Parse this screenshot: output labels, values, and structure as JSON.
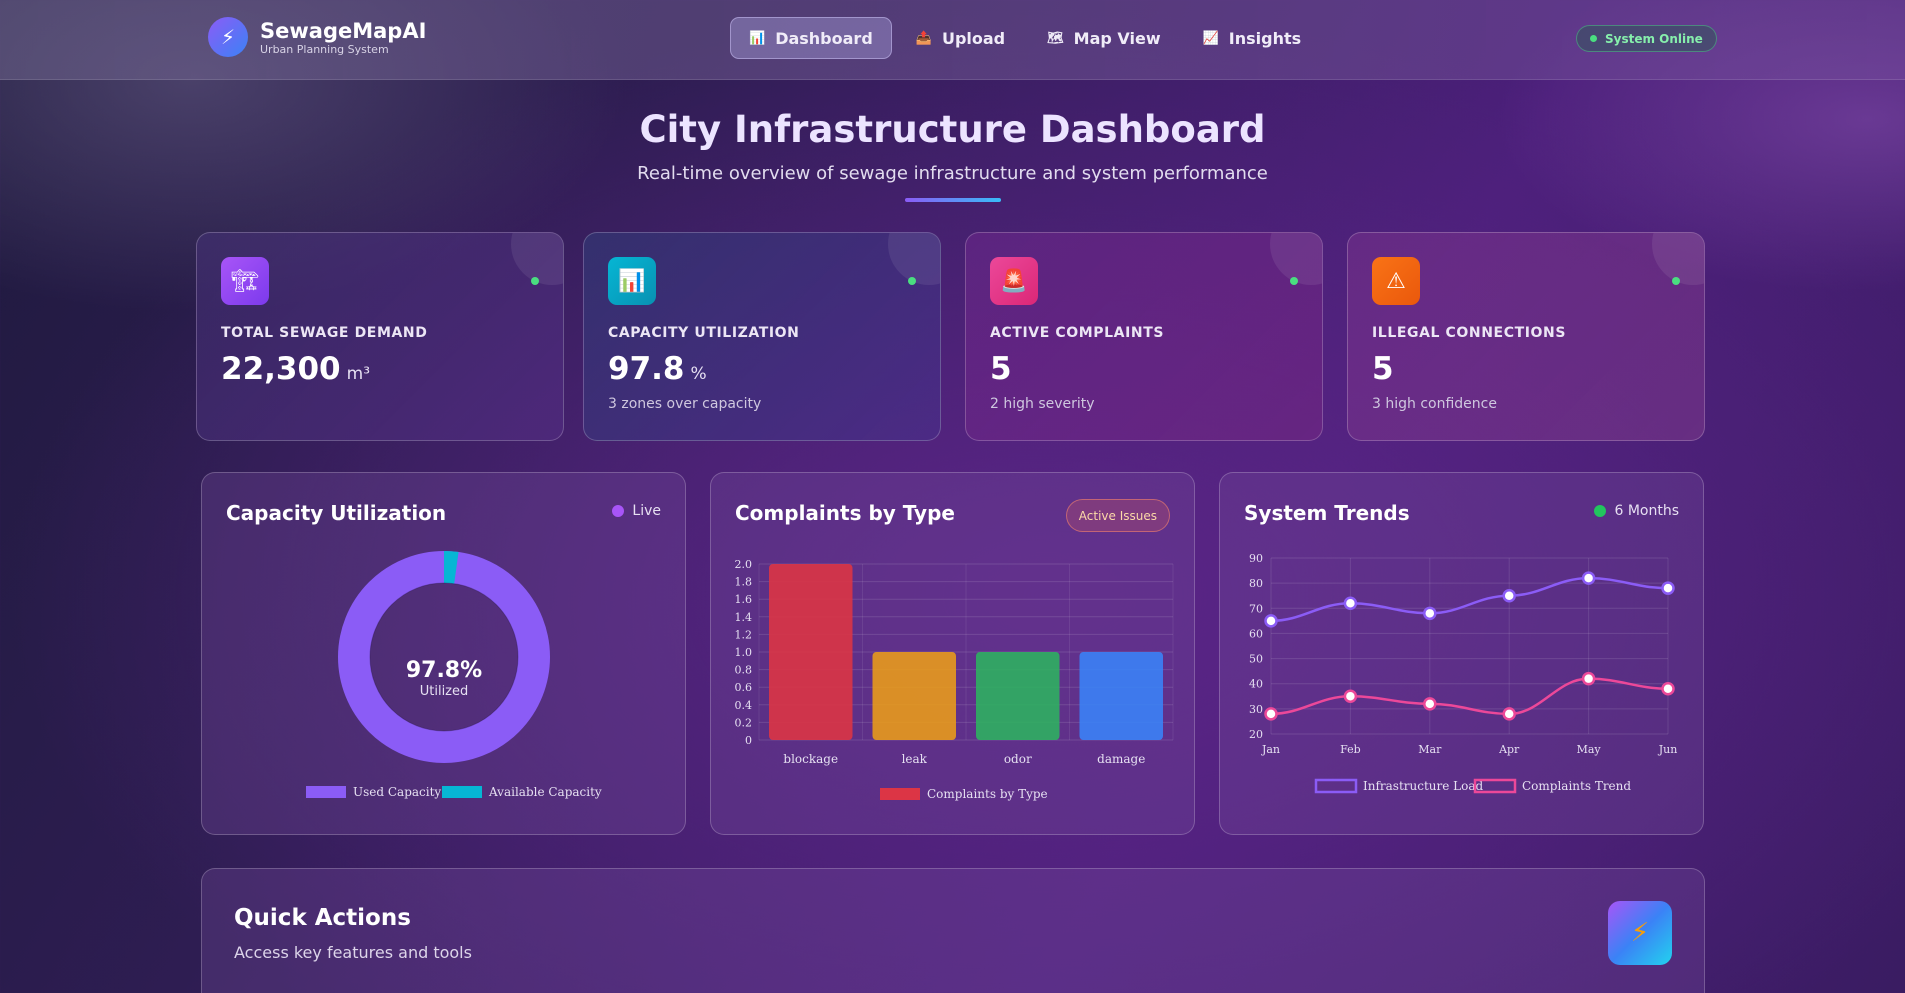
{
  "brand": {
    "name": "SewageMapAI",
    "subtitle": "Urban Planning System",
    "logo_icon": "bolt-icon"
  },
  "nav": [
    {
      "label": "Dashboard",
      "icon": "dashboard-icon",
      "active": true
    },
    {
      "label": "Upload",
      "icon": "upload-icon",
      "active": false
    },
    {
      "label": "Map View",
      "icon": "map-icon",
      "active": false
    },
    {
      "label": "Insights",
      "icon": "insights-icon",
      "active": false
    }
  ],
  "status": "System Online",
  "hero": {
    "title": "City Infrastructure Dashboard",
    "subtitle": "Real-time overview of sewage infrastructure and system performance"
  },
  "stats": [
    {
      "label": "TOTAL SEWAGE DEMAND",
      "value": "22,300",
      "unit": "m³",
      "note": "",
      "icon": "pipe-icon",
      "icon_color": "#a855f7"
    },
    {
      "label": "CAPACITY UTILIZATION",
      "value": "97.8",
      "unit": "%",
      "note": "3 zones over capacity",
      "icon": "bar-chart-icon",
      "icon_color": "#06b6d4"
    },
    {
      "label": "ACTIVE COMPLAINTS",
      "value": "5",
      "unit": "",
      "note": "2 high severity",
      "icon": "siren-icon",
      "icon_color": "#ec4899"
    },
    {
      "label": "ILLEGAL CONNECTIONS",
      "value": "5",
      "unit": "",
      "note": "3 high confidence",
      "icon": "warning-icon",
      "icon_color": "#f97316"
    }
  ],
  "panels": {
    "capacity": {
      "title": "Capacity Utilization",
      "pill": "Live",
      "pill_color": "#a855f7",
      "center_value": "97.8%",
      "center_label": "Utilized"
    },
    "complaints": {
      "title": "Complaints by Type",
      "badge": "Active Issues"
    },
    "trends": {
      "title": "System Trends",
      "pill": "6 Months",
      "pill_color": "#22c55e"
    }
  },
  "quick_actions": {
    "title": "Quick Actions",
    "subtitle": "Access key features and tools",
    "icon": "bolt-icon"
  },
  "chart_data": [
    {
      "type": "pie",
      "donut": true,
      "labels": [
        "Used Capacity",
        "Available Capacity"
      ],
      "values": [
        97.8,
        2.2
      ],
      "colors": [
        "#8b5cf6",
        "#06b6d4"
      ]
    },
    {
      "type": "bar",
      "categories": [
        "blockage",
        "leak",
        "odor",
        "damage"
      ],
      "series": [
        {
          "name": "Complaints by Type",
          "values": [
            2,
            1,
            1,
            1
          ]
        }
      ],
      "colors": [
        "#dc3545",
        "#e89a1c",
        "#2fb060",
        "#3b82f6"
      ],
      "ylim": [
        0,
        2
      ],
      "yticks": [
        "0",
        "0.2",
        "0.4",
        "0.6",
        "0.8",
        "1.0",
        "1.2",
        "1.4",
        "1.6",
        "1.8",
        "2.0"
      ]
    },
    {
      "type": "line",
      "categories": [
        "Jan",
        "Feb",
        "Mar",
        "Apr",
        "May",
        "Jun"
      ],
      "series": [
        {
          "name": "Infrastructure Load",
          "values": [
            65,
            72,
            68,
            75,
            82,
            78
          ],
          "color": "#8b5cf6"
        },
        {
          "name": "Complaints Trend",
          "values": [
            28,
            35,
            32,
            28,
            42,
            38
          ],
          "color": "#ec4899"
        }
      ],
      "ylim": [
        20,
        90
      ],
      "yticks": [
        "20",
        "30",
        "40",
        "50",
        "60",
        "70",
        "80",
        "90"
      ]
    }
  ]
}
